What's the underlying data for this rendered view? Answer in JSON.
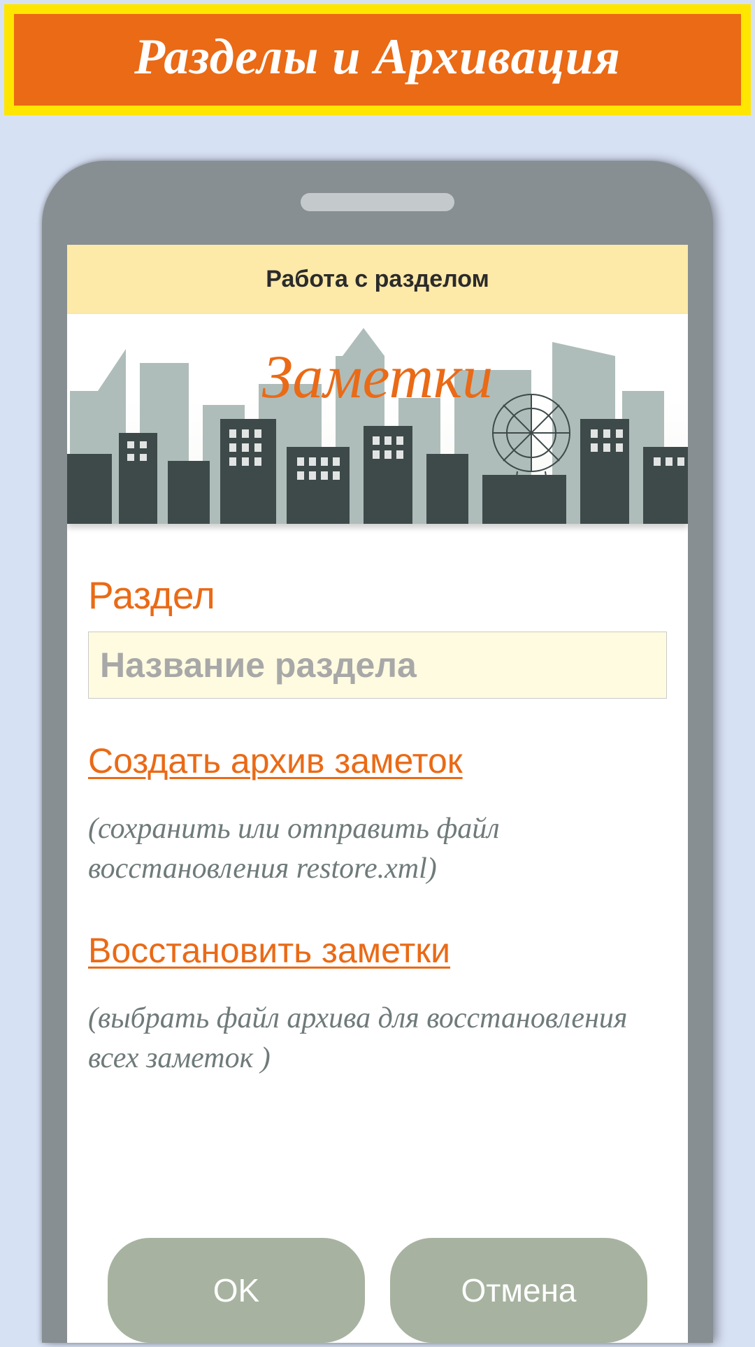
{
  "banner": {
    "title": "Разделы и Архивация"
  },
  "appbar": {
    "title": "Работа с разделом"
  },
  "city_banner": {
    "title": "Заметки"
  },
  "section": {
    "label": "Раздел",
    "placeholder": "Название раздела"
  },
  "actions": {
    "archive": {
      "label": "Создать архив заметок",
      "hint": "(сохранить или отправить файл восстановления  restore.xml)"
    },
    "restore": {
      "label": "Восстановить заметки",
      "hint": "(выбрать файл архива для восстановления всех заметок )"
    }
  },
  "buttons": {
    "ok": "OK",
    "cancel": "Отмена"
  }
}
